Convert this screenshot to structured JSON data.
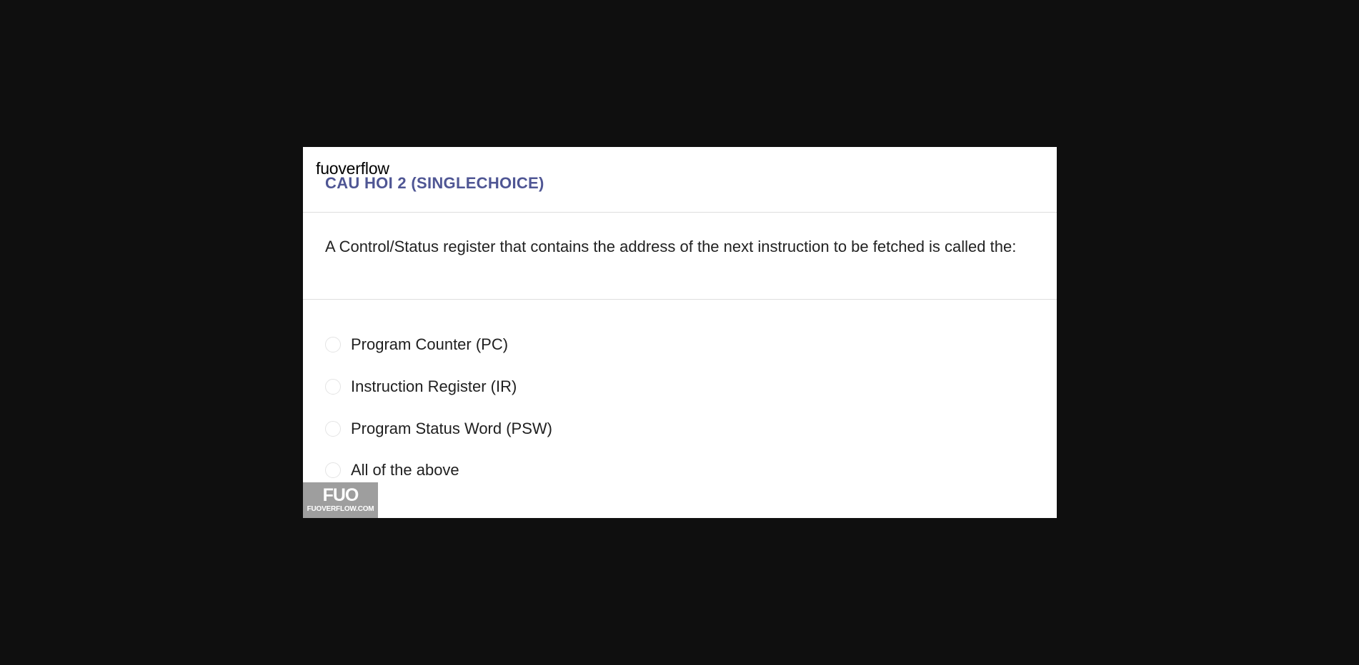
{
  "site": {
    "label": "fuoverflow"
  },
  "question": {
    "header": "CAU HOI 2 (SINGLECHOICE)",
    "text": "A Control/Status register that contains the address of the next instruction to be fetched is called the:",
    "options": [
      {
        "label": "Program Counter (PC)",
        "selected": false
      },
      {
        "label": "Instruction Register (IR)",
        "selected": false
      },
      {
        "label": "Program Status Word (PSW)",
        "selected": false
      },
      {
        "label": "All of the above",
        "selected": false
      }
    ]
  },
  "watermark": {
    "mark": "FUO",
    "url": "FUOVERFLOW.COM"
  },
  "colors": {
    "page_background": "#0f0f0f",
    "panel_background": "#ffffff",
    "header_accent": "#4f5694",
    "watermark_background": "#9e9e9e"
  }
}
